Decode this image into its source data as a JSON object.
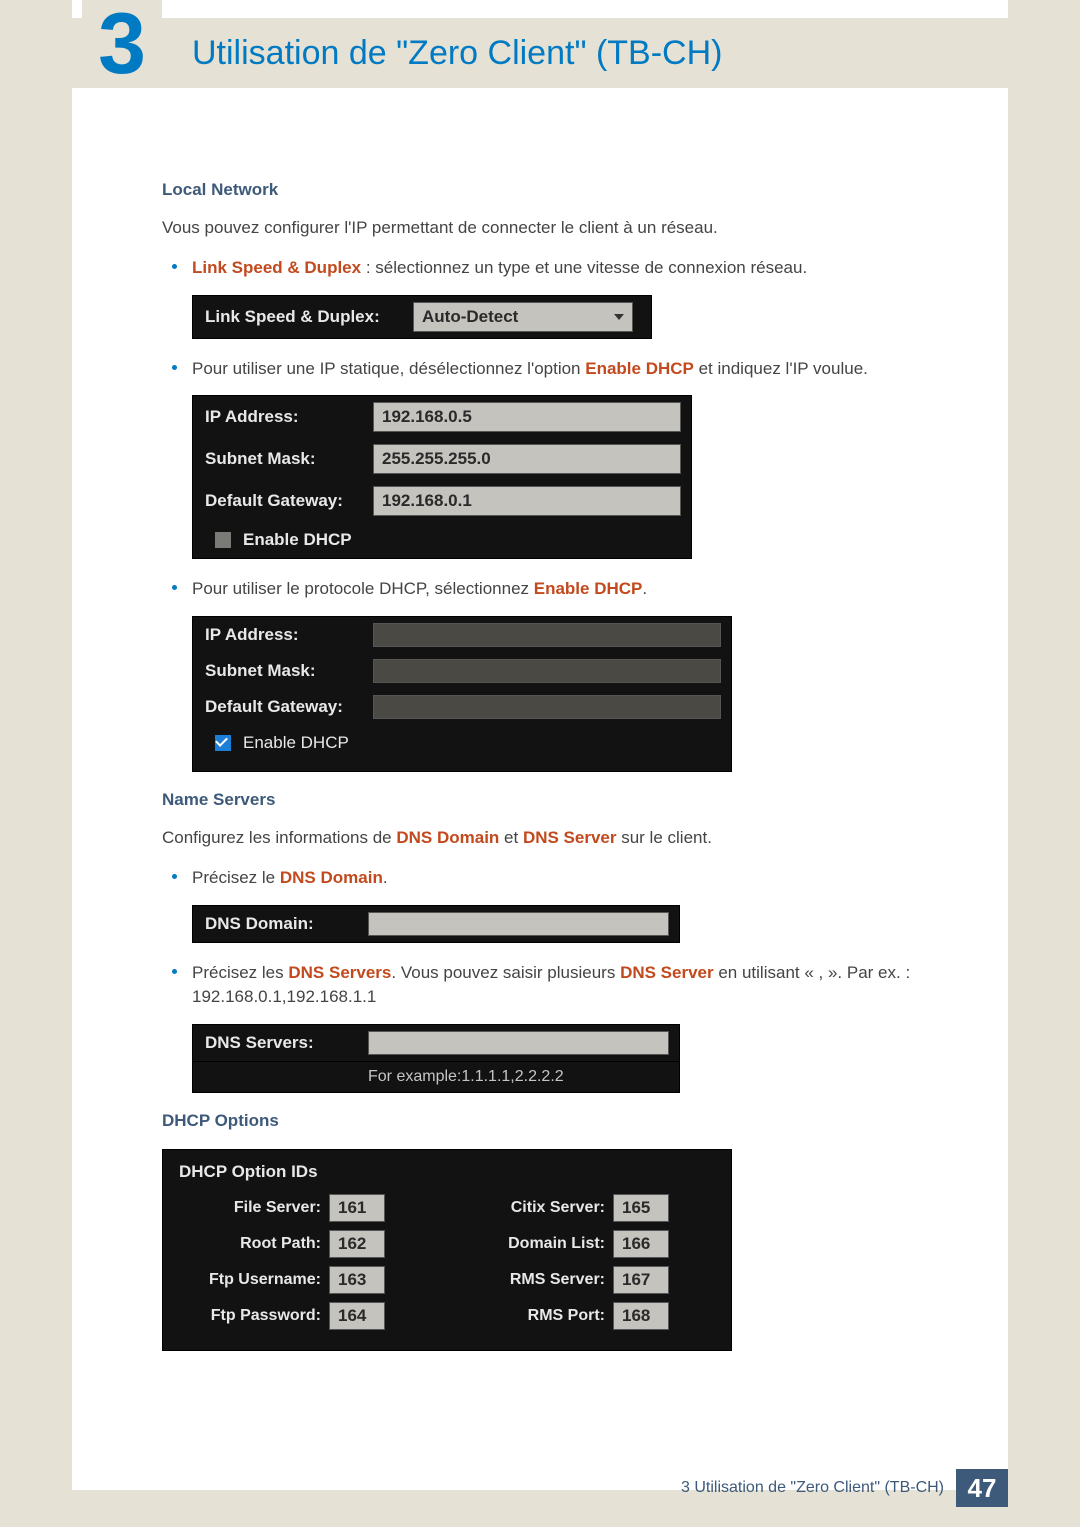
{
  "header": {
    "chapter_num": "3",
    "title": "Utilisation de \"Zero Client\" (TB-CH)"
  },
  "local_network": {
    "heading": "Local Network",
    "intro": "Vous pouvez configurer l'IP permettant de connecter le client à un réseau.",
    "bullet1_pre": "Link Speed & Duplex",
    "bullet1_post": " : sélectionnez un type et une vitesse de connexion réseau.",
    "linkspeed_label": "Link Speed & Duplex:",
    "linkspeed_value": "Auto-Detect",
    "bullet2_pre": "Pour utiliser une IP statique, désélectionnez l'option ",
    "bullet2_em": "Enable DHCP",
    "bullet2_post": " et indiquez l'IP voulue.",
    "ip_label": "IP Address:",
    "ip_value": "192.168.0.5",
    "mask_label": "Subnet Mask:",
    "mask_value": "255.255.255.0",
    "gw_label": "Default Gateway:",
    "gw_value": "192.168.0.1",
    "enable_dhcp": "Enable DHCP",
    "bullet3_pre": "Pour utiliser le protocole DHCP, sélectionnez ",
    "bullet3_em": "Enable DHCP",
    "bullet3_post": "."
  },
  "name_servers": {
    "heading": "Name Servers",
    "intro_pre": "Configurez les informations de ",
    "intro_em1": "DNS Domain",
    "intro_mid": " et ",
    "intro_em2": "DNS Server",
    "intro_post": " sur le client.",
    "bullet1_pre": "Précisez le ",
    "bullet1_em": "DNS Domain",
    "bullet1_post": ".",
    "dns_domain_label": "DNS Domain:",
    "bullet2_pre": "Précisez les ",
    "bullet2_em1": "DNS Servers",
    "bullet2_mid": ". Vous pouvez saisir plusieurs ",
    "bullet2_em2": "DNS Server",
    "bullet2_post": " en utilisant « , ». Par ex. : 192.168.0.1,192.168.1.1",
    "dns_servers_label": "DNS Servers:",
    "dns_example": "For example:1.1.1.1,2.2.2.2"
  },
  "dhcp_options": {
    "heading": "DHCP Options",
    "title": "DHCP Option IDs",
    "left": [
      {
        "label": "File Server:",
        "value": "161"
      },
      {
        "label": "Root Path:",
        "value": "162"
      },
      {
        "label": "Ftp Username:",
        "value": "163"
      },
      {
        "label": "Ftp Password:",
        "value": "164"
      }
    ],
    "right": [
      {
        "label": "Citix Server:",
        "value": "165"
      },
      {
        "label": "Domain List:",
        "value": "166"
      },
      {
        "label": "RMS Server:",
        "value": "167"
      },
      {
        "label": "RMS Port:",
        "value": "168"
      }
    ]
  },
  "footer": {
    "title": "3 Utilisation de \"Zero Client\" (TB-CH)",
    "page": "47"
  }
}
